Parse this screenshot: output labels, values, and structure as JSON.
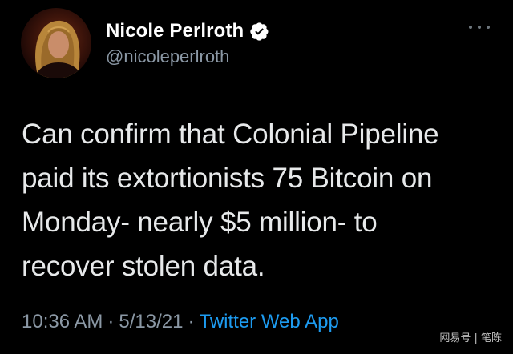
{
  "tweet": {
    "author": {
      "display_name": "Nicole Perlroth",
      "handle": "@nicoleperlroth",
      "verified": true,
      "avatar_icon": "profile-photo"
    },
    "more_icon": "more-options-icon",
    "text_lines": [
      "Can confirm that Colonial Pipeline",
      "paid its extortionists 75 Bitcoin on",
      "Monday- nearly $5 million- to",
      "recover stolen data."
    ],
    "time": "10:36 AM",
    "separator": "·",
    "date": "5/13/21",
    "source": "Twitter Web App"
  },
  "watermark": "网易号 | 笔陈",
  "colors": {
    "background": "#000000",
    "primary_text": "#e7e9ea",
    "secondary_text": "#8b98a5",
    "link": "#1d9bf0",
    "verified_badge": "#ffffff"
  }
}
